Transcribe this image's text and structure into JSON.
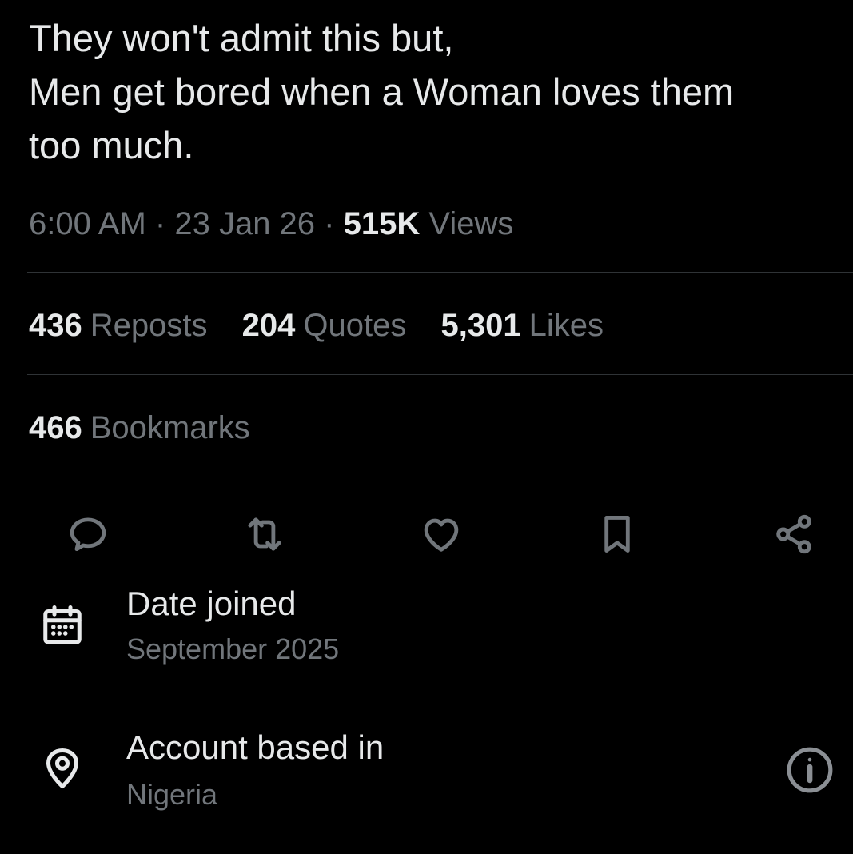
{
  "tweet": {
    "lines": [
      "They won't admit this but,",
      "Men get bored when a Woman loves them",
      "too much."
    ],
    "time": "6:00 AM",
    "date": "23 Jan 26",
    "views_count": "515K",
    "views_label": "Views",
    "dot": "·"
  },
  "stats": {
    "reposts": {
      "count": "436",
      "label": "Reposts"
    },
    "quotes": {
      "count": "204",
      "label": "Quotes"
    },
    "likes": {
      "count": "5,301",
      "label": "Likes"
    },
    "bookmarks": {
      "count": "466",
      "label": "Bookmarks"
    }
  },
  "actions": [
    "reply-icon",
    "repost-icon",
    "like-icon",
    "bookmark-icon",
    "share-icon"
  ],
  "about": {
    "date_joined": {
      "title": "Date joined",
      "value": "September 2025",
      "icon": "calendar-icon"
    },
    "location": {
      "title": "Account based in",
      "value": "Nigeria",
      "icon": "location-pin-icon",
      "help_icon": "info-icon"
    }
  },
  "colors": {
    "background": "#000000",
    "primary_text": "#e7e9ea",
    "secondary_text": "#71767b",
    "divider": "#2f3336"
  }
}
